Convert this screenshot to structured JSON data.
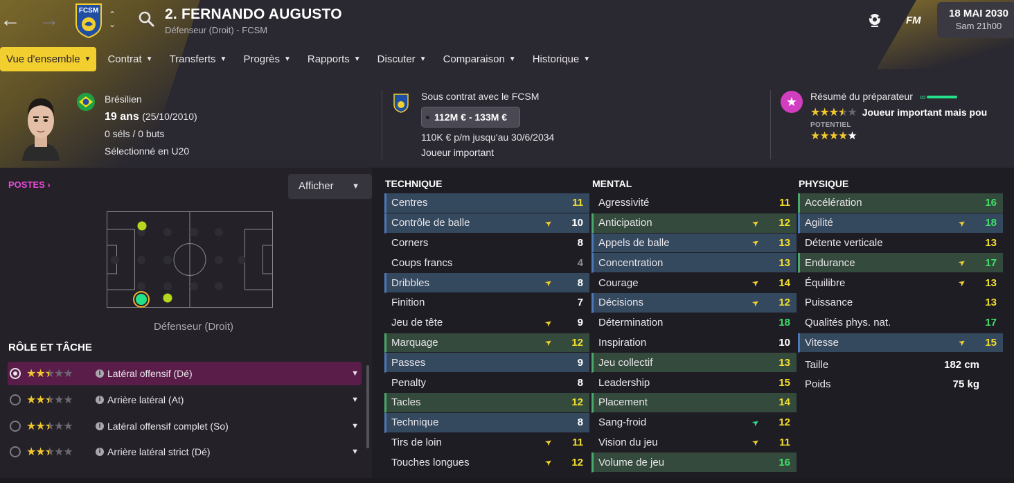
{
  "header": {
    "player_name": "2. FERNANDO AUGUSTO",
    "player_sub": "Défenseur (Droit) - FCSM",
    "club_crest_text": "FCSM",
    "fm_logo": "FM",
    "date": "18 MAI 2030",
    "time": "Sam 21h00"
  },
  "tabs": [
    {
      "label": "Vue d'ensemble",
      "active": true
    },
    {
      "label": "Contrat"
    },
    {
      "label": "Transferts"
    },
    {
      "label": "Progrès"
    },
    {
      "label": "Rapports"
    },
    {
      "label": "Discuter"
    },
    {
      "label": "Comparaison"
    },
    {
      "label": "Historique"
    }
  ],
  "personal": {
    "nationality": "Brésilien",
    "age": "19 ans",
    "dob": "(25/10/2010)",
    "caps": "0 séls / 0 buts",
    "selection": "Sélectionné en U20"
  },
  "contract": {
    "status": "Sous contrat avec le FCSM",
    "value": "112M € - 133M €",
    "wage": "110K € p/m jusqu'au 30/6/2034",
    "role": "Joueur important"
  },
  "scout": {
    "summary_label": "Résumé du préparateur",
    "ability_stars": 3.5,
    "verdict": "Joueur important mais pou",
    "potential_label": "POTENTIEL",
    "potential_stars": 4.5
  },
  "positions": {
    "title": "POSTES",
    "display_button": "Afficher",
    "caption": "Défenseur (Droit)"
  },
  "roles": {
    "title": "RÔLE ET TÂCHE",
    "items": [
      {
        "label": "Latéral offensif (Dé)",
        "stars": 2.5,
        "selected": true
      },
      {
        "label": "Arrière latéral (At)",
        "stars": 2.5
      },
      {
        "label": "Latéral offensif complet (So)",
        "stars": 2.5
      },
      {
        "label": "Arrière latéral strict (Dé)",
        "stars": 2.5
      }
    ]
  },
  "attributes": {
    "technique": {
      "title": "TECHNIQUE",
      "rows": [
        {
          "name": "Centres",
          "value": "11",
          "hl": "blue",
          "arrow": "",
          "color": "yellow"
        },
        {
          "name": "Contrôle de balle",
          "value": "10",
          "hl": "blue",
          "arrow": "up",
          "color": "white"
        },
        {
          "name": "Corners",
          "value": "8",
          "hl": "",
          "arrow": "",
          "color": "white"
        },
        {
          "name": "Coups francs",
          "value": "4",
          "hl": "",
          "arrow": "",
          "color": "grey"
        },
        {
          "name": "Dribbles",
          "value": "8",
          "hl": "blue",
          "arrow": "up",
          "color": "white"
        },
        {
          "name": "Finition",
          "value": "7",
          "hl": "",
          "arrow": "",
          "color": "white"
        },
        {
          "name": "Jeu de tête",
          "value": "9",
          "hl": "",
          "arrow": "up",
          "color": "white"
        },
        {
          "name": "Marquage",
          "value": "12",
          "hl": "green",
          "arrow": "up",
          "color": "yellow"
        },
        {
          "name": "Passes",
          "value": "9",
          "hl": "blue",
          "arrow": "",
          "color": "white"
        },
        {
          "name": "Penalty",
          "value": "8",
          "hl": "",
          "arrow": "",
          "color": "white"
        },
        {
          "name": "Tacles",
          "value": "12",
          "hl": "green",
          "arrow": "",
          "color": "yellow"
        },
        {
          "name": "Technique",
          "value": "8",
          "hl": "blue",
          "arrow": "",
          "color": "white"
        },
        {
          "name": "Tirs de loin",
          "value": "11",
          "hl": "",
          "arrow": "up",
          "color": "yellow"
        },
        {
          "name": "Touches longues",
          "value": "12",
          "hl": "",
          "arrow": "up",
          "color": "yellow"
        }
      ]
    },
    "mental": {
      "title": "MENTAL",
      "rows": [
        {
          "name": "Agressivité",
          "value": "11",
          "hl": "",
          "arrow": "",
          "color": "yellow"
        },
        {
          "name": "Anticipation",
          "value": "12",
          "hl": "green",
          "arrow": "up",
          "color": "yellow"
        },
        {
          "name": "Appels de balle",
          "value": "13",
          "hl": "blue",
          "arrow": "up",
          "color": "yellow"
        },
        {
          "name": "Concentration",
          "value": "13",
          "hl": "blue",
          "arrow": "",
          "color": "yellow"
        },
        {
          "name": "Courage",
          "value": "14",
          "hl": "",
          "arrow": "up",
          "color": "yellow"
        },
        {
          "name": "Décisions",
          "value": "12",
          "hl": "blue",
          "arrow": "up",
          "color": "yellow"
        },
        {
          "name": "Détermination",
          "value": "18",
          "hl": "",
          "arrow": "",
          "color": "green"
        },
        {
          "name": "Inspiration",
          "value": "10",
          "hl": "",
          "arrow": "",
          "color": "white"
        },
        {
          "name": "Jeu collectif",
          "value": "13",
          "hl": "green",
          "arrow": "",
          "color": "yellow"
        },
        {
          "name": "Leadership",
          "value": "15",
          "hl": "",
          "arrow": "",
          "color": "yellow"
        },
        {
          "name": "Placement",
          "value": "14",
          "hl": "green",
          "arrow": "",
          "color": "yellow"
        },
        {
          "name": "Sang-froid",
          "value": "12",
          "hl": "",
          "arrow": "upgreen",
          "color": "yellow"
        },
        {
          "name": "Vision du jeu",
          "value": "11",
          "hl": "",
          "arrow": "up",
          "color": "yellow"
        },
        {
          "name": "Volume de jeu",
          "value": "16",
          "hl": "green",
          "arrow": "",
          "color": "green"
        }
      ]
    },
    "physique": {
      "title": "PHYSIQUE",
      "rows": [
        {
          "name": "Accélération",
          "value": "16",
          "hl": "green",
          "arrow": "",
          "color": "green"
        },
        {
          "name": "Agilité",
          "value": "18",
          "hl": "blue",
          "arrow": "up",
          "color": "green"
        },
        {
          "name": "Détente verticale",
          "value": "13",
          "hl": "",
          "arrow": "",
          "color": "yellow"
        },
        {
          "name": "Endurance",
          "value": "17",
          "hl": "green",
          "arrow": "up",
          "color": "green"
        },
        {
          "name": "Équilibre",
          "value": "13",
          "hl": "",
          "arrow": "up",
          "color": "yellow"
        },
        {
          "name": "Puissance",
          "value": "13",
          "hl": "",
          "arrow": "",
          "color": "yellow"
        },
        {
          "name": "Qualités phys. nat.",
          "value": "17",
          "hl": "",
          "arrow": "",
          "color": "green"
        },
        {
          "name": "Vitesse",
          "value": "15",
          "hl": "blue",
          "arrow": "up",
          "color": "yellow"
        }
      ],
      "height_label": "Taille",
      "height_value": "182 cm",
      "weight_label": "Poids",
      "weight_value": "75 kg"
    }
  },
  "colors": {
    "accent_yellow": "#f2cf2e",
    "accent_pink": "#e84ad6",
    "attr_green": "#3ee06a",
    "attr_yellow": "#f2df2e"
  },
  "icons": {
    "back": "arrow-left-icon",
    "forward": "arrow-right-icon",
    "search": "search-icon",
    "ball": "ball-icon",
    "star": "star-icon",
    "info": "info-icon",
    "chevron": "chevron-down-icon"
  }
}
